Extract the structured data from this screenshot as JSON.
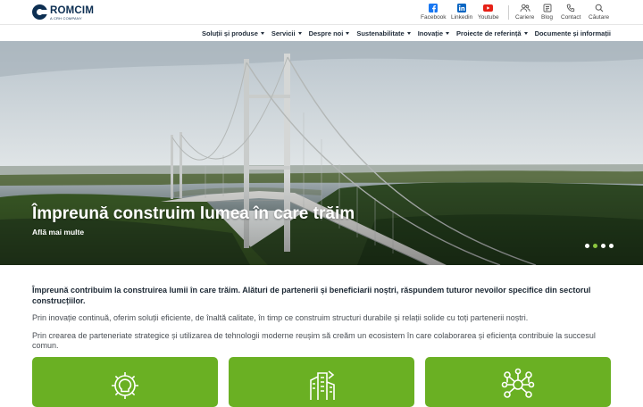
{
  "brand": {
    "name": "ROMCIM",
    "tagline": "A CRH COMPANY",
    "color": "#0d2f52"
  },
  "utility_links": [
    {
      "label": "Facebook",
      "icon": "facebook-icon"
    },
    {
      "label": "Linkedin",
      "icon": "linkedin-icon"
    },
    {
      "label": "Youtube",
      "icon": "youtube-icon"
    },
    {
      "label": "Cariere",
      "icon": "people-icon"
    },
    {
      "label": "Blog",
      "icon": "blog-icon"
    },
    {
      "label": "Contact",
      "icon": "phone-icon"
    },
    {
      "label": "Căutare",
      "icon": "search-icon"
    }
  ],
  "nav": [
    {
      "label": "Soluții și produse",
      "has_dropdown": true
    },
    {
      "label": "Servicii",
      "has_dropdown": true
    },
    {
      "label": "Despre noi",
      "has_dropdown": true
    },
    {
      "label": "Sustenabilitate",
      "has_dropdown": true
    },
    {
      "label": "Inovație",
      "has_dropdown": true
    },
    {
      "label": "Proiecte de referință",
      "has_dropdown": true
    },
    {
      "label": "Documente și informații",
      "has_dropdown": false
    }
  ],
  "hero": {
    "title": "Împreună construim lumea în care trăim",
    "link": "Află mai multe",
    "slides": 4,
    "active_slide": 2
  },
  "intro": {
    "lead": "Împreună contribuim la construirea lumii în care trăim. Alături de partenerii și beneficiarii noștri, răspundem tuturor nevoilor specifice din sectorul construcțiilor.",
    "p1": "Prin inovație continuă, oferim soluții eficiente, de înaltă calitate, în timp ce construim structuri durabile și relații solide cu toți partenerii noștri.",
    "p2": "Prin crearea de parteneriate strategice și utilizarea de tehnologii moderne reușim să creăm un ecosistem în care colaborarea și eficiența contribuie la succesul comun."
  },
  "cards": [
    {
      "icon": "gear-bulb-icon"
    },
    {
      "icon": "buildings-icon"
    },
    {
      "icon": "network-icon"
    }
  ],
  "colors": {
    "accent_green": "#6ab023",
    "dot_active": "#8cc63f",
    "facebook": "#1877f2",
    "linkedin": "#0a66c2",
    "youtube": "#e62117"
  }
}
